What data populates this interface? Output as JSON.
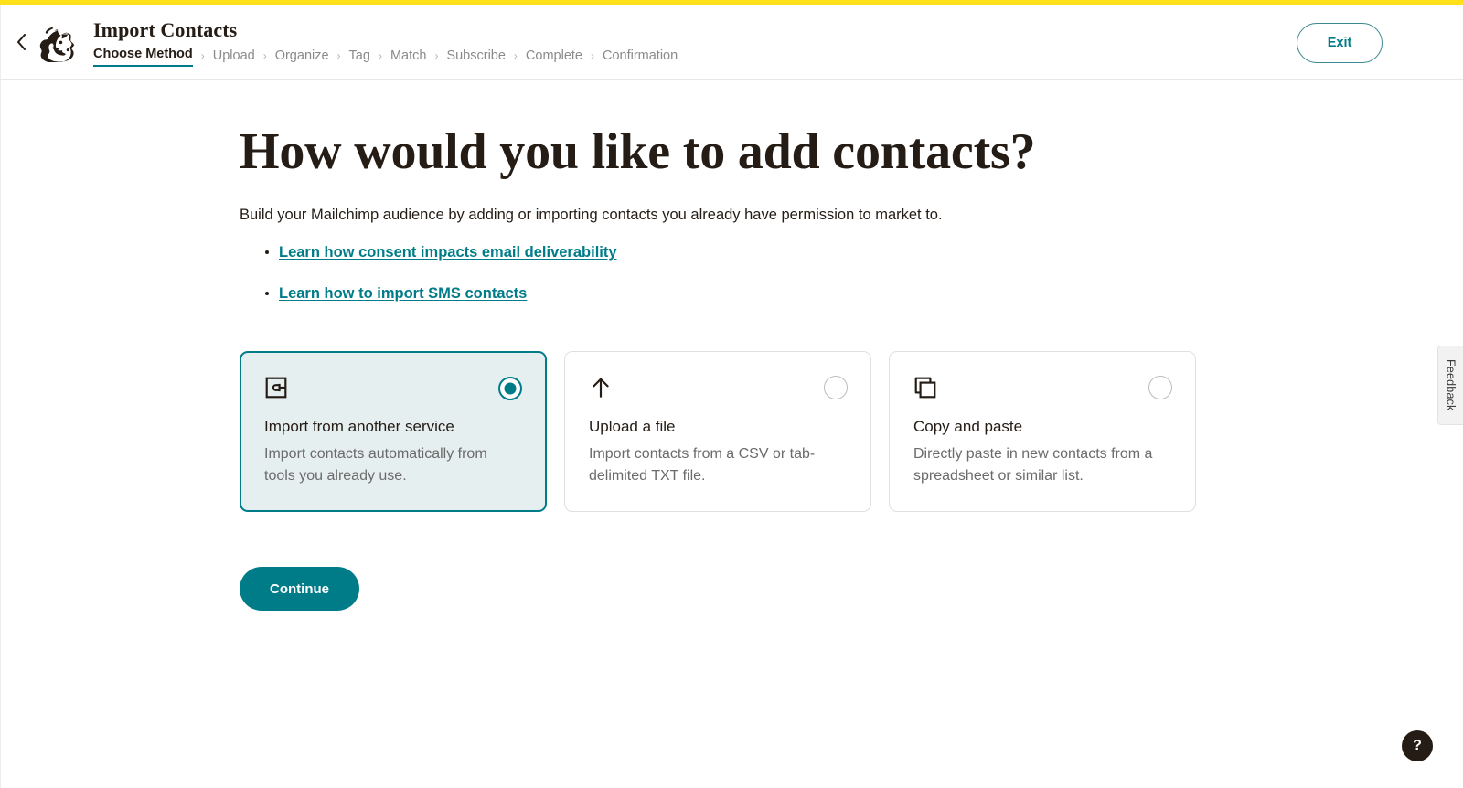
{
  "brand": {
    "accent_yellow": "#FFE01B",
    "accent_teal": "#007C89",
    "text_dark": "#241C15",
    "text_muted": "#6B6B6B",
    "selected_card_bg": "#E6EFF0"
  },
  "header": {
    "back_icon": "chevron-left-icon",
    "logo_icon": "mailchimp-freddie-logo",
    "title": "Import Contacts",
    "exit_label": "Exit",
    "breadcrumb": [
      {
        "label": "Choose Method",
        "active": true
      },
      {
        "label": "Upload",
        "active": false
      },
      {
        "label": "Organize",
        "active": false
      },
      {
        "label": "Tag",
        "active": false
      },
      {
        "label": "Match",
        "active": false
      },
      {
        "label": "Subscribe",
        "active": false
      },
      {
        "label": "Complete",
        "active": false
      },
      {
        "label": "Confirmation",
        "active": false
      }
    ],
    "separator": "›"
  },
  "main": {
    "headline": "How would you like to add contacts?",
    "intro": "Build your Mailchimp audience by adding or importing contacts you already have permission to market to.",
    "links": [
      {
        "label": "Learn how consent impacts email deliverability"
      },
      {
        "label": "Learn how to import SMS contacts"
      }
    ],
    "options": [
      {
        "icon": "integration-plug-icon",
        "title": "Import from another service",
        "description": "Import contacts automatically from tools you already use.",
        "selected": true
      },
      {
        "icon": "upload-arrow-icon",
        "title": "Upload a file",
        "description": "Import contacts from a CSV or tab-delimited TXT file.",
        "selected": false
      },
      {
        "icon": "copy-duplicate-icon",
        "title": "Copy and paste",
        "description": "Directly paste in new contacts from a spreadsheet or similar list.",
        "selected": false
      }
    ],
    "continue_label": "Continue"
  },
  "feedback": {
    "label": "Feedback"
  },
  "help": {
    "label": "?",
    "icon": "question-mark-icon"
  }
}
